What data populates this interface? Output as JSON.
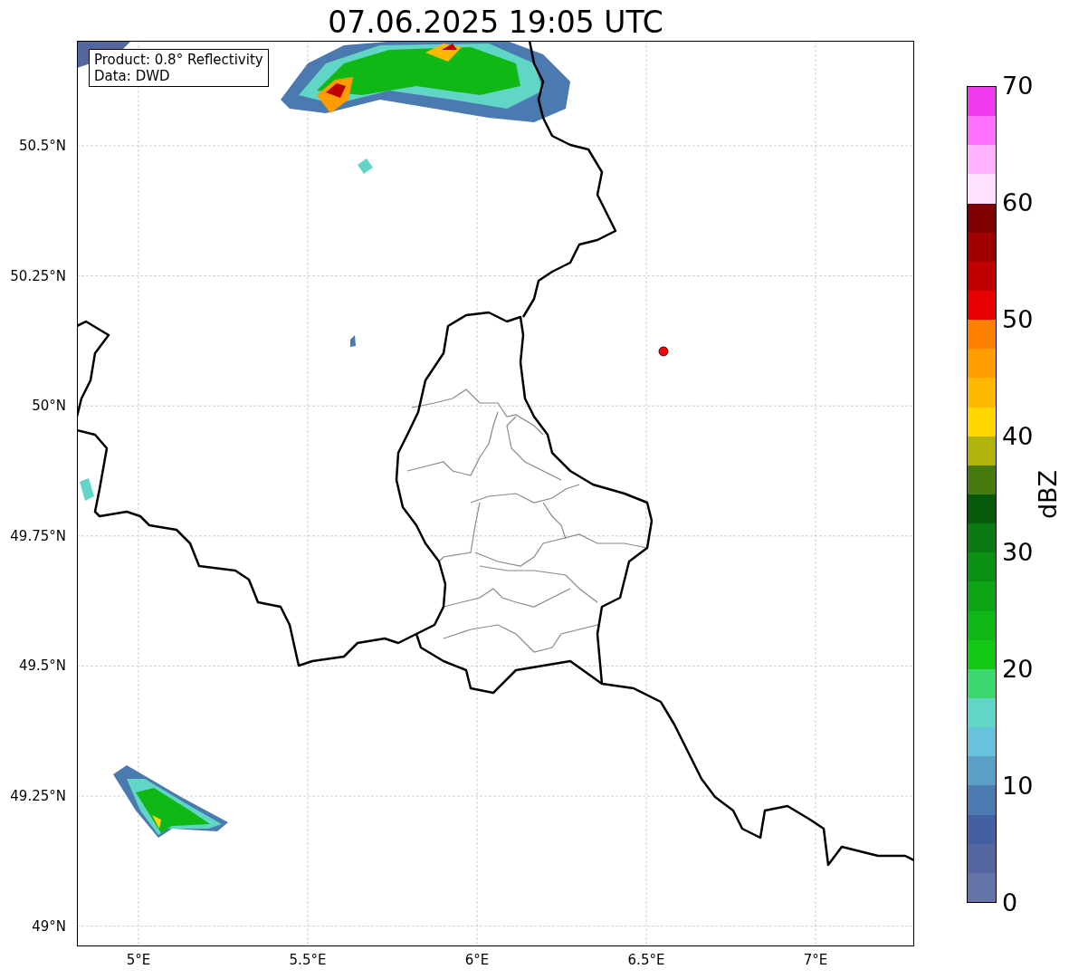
{
  "title": "07.06.2025 19:05 UTC",
  "map": {
    "info_lines": [
      "Product: 0.8° Reflectivity",
      "Data: DWD"
    ],
    "x_ticks": [
      "5°E",
      "5.5°E",
      "6°E",
      "6.5°E",
      "7°E"
    ],
    "y_ticks": [
      "50.5°N",
      "50.25°N",
      "50°N",
      "49.75°N",
      "49.5°N",
      "49.25°N",
      "49°N"
    ]
  },
  "colorbar": {
    "label": "dBZ",
    "ticks": [
      "70",
      "60",
      "50",
      "40",
      "30",
      "20",
      "10",
      "0"
    ],
    "bins": [
      {
        "color": "#6474a8"
      },
      {
        "color": "#5567a0"
      },
      {
        "color": "#4360a3"
      },
      {
        "color": "#4a7ab0"
      },
      {
        "color": "#5b9fc6"
      },
      {
        "color": "#67c2dc"
      },
      {
        "color": "#62d6c6"
      },
      {
        "color": "#3dd670"
      },
      {
        "color": "#12c815"
      },
      {
        "color": "#10b816"
      },
      {
        "color": "#0ea515"
      },
      {
        "color": "#0c9012"
      },
      {
        "color": "#0b7a12"
      },
      {
        "color": "#075a0c"
      },
      {
        "color": "#487a0d"
      },
      {
        "color": "#b0b30c"
      },
      {
        "color": "#ffd600"
      },
      {
        "color": "#ffb800"
      },
      {
        "color": "#ff9c00"
      },
      {
        "color": "#ff8000"
      },
      {
        "color": "#e60000"
      },
      {
        "color": "#c00000"
      },
      {
        "color": "#a00000"
      },
      {
        "color": "#7f0000"
      },
      {
        "color": "#ffe0ff"
      },
      {
        "color": "#ffb3ff"
      },
      {
        "color": "#ff70ff"
      },
      {
        "color": "#ee3aee"
      }
    ]
  }
}
